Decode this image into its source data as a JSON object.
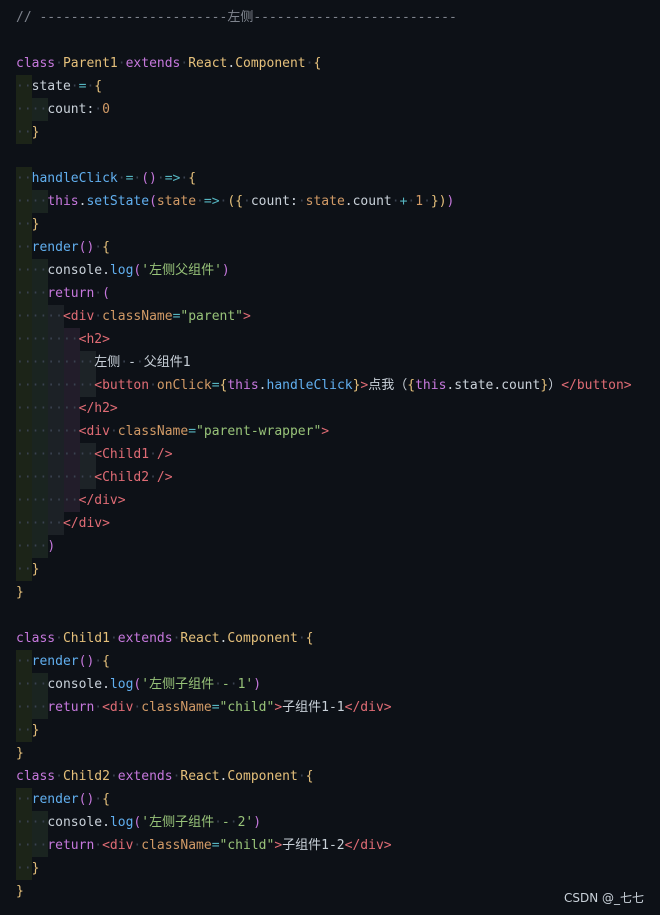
{
  "editor": {
    "lines": [
      [
        [
          "c",
          "// ------------------------左侧--------------------------"
        ]
      ],
      [],
      [
        [
          "k",
          "class"
        ],
        [
          "ws",
          "·"
        ],
        [
          "cl",
          "Parent1"
        ],
        [
          "ws",
          "·"
        ],
        [
          "k",
          "extends"
        ],
        [
          "ws",
          "·"
        ],
        [
          "cl",
          "React"
        ],
        [
          "p",
          "."
        ],
        [
          "cl",
          "Component"
        ],
        [
          "ws",
          "·"
        ],
        [
          "pb",
          "{"
        ]
      ],
      [
        [
          "p",
          "state"
        ],
        [
          "ws",
          "·"
        ],
        [
          "op",
          "="
        ],
        [
          "ws",
          "·"
        ],
        [
          "pb",
          "{"
        ]
      ],
      [
        [
          "p",
          "count"
        ],
        [
          "p",
          ":"
        ],
        [
          "ws",
          "·"
        ],
        [
          "n",
          "0"
        ]
      ],
      [
        [
          "pb",
          "}"
        ]
      ],
      [],
      [
        [
          "f",
          "handleClick"
        ],
        [
          "ws",
          "·"
        ],
        [
          "op",
          "="
        ],
        [
          "ws",
          "·"
        ],
        [
          "pp",
          "()"
        ],
        [
          "ws",
          "·"
        ],
        [
          "op",
          "=>"
        ],
        [
          "ws",
          "·"
        ],
        [
          "pb",
          "{"
        ]
      ],
      [
        [
          "k",
          "this"
        ],
        [
          "p",
          "."
        ],
        [
          "f",
          "setState"
        ],
        [
          "pp",
          "("
        ],
        [
          "a",
          "state"
        ],
        [
          "ws",
          "·"
        ],
        [
          "op",
          "=>"
        ],
        [
          "ws",
          "·"
        ],
        [
          "pb",
          "("
        ],
        [
          "pb",
          "{"
        ],
        [
          "ws",
          "·"
        ],
        [
          "p",
          "count"
        ],
        [
          "p",
          ":"
        ],
        [
          "ws",
          "·"
        ],
        [
          "a",
          "state"
        ],
        [
          "p",
          "."
        ],
        [
          "p",
          "count"
        ],
        [
          "ws",
          "·"
        ],
        [
          "op",
          "+"
        ],
        [
          "ws",
          "·"
        ],
        [
          "n",
          "1"
        ],
        [
          "ws",
          "·"
        ],
        [
          "pb",
          "}"
        ],
        [
          "pb",
          ")"
        ],
        [
          "pp",
          ")"
        ]
      ],
      [
        [
          "pb",
          "}"
        ]
      ],
      [
        [
          "f",
          "render"
        ],
        [
          "pp",
          "()"
        ],
        [
          "ws",
          "·"
        ],
        [
          "pb",
          "{"
        ]
      ],
      [
        [
          "p",
          "console"
        ],
        [
          "p",
          "."
        ],
        [
          "f",
          "log"
        ],
        [
          "pp",
          "("
        ],
        [
          "s",
          "'左侧父组件'"
        ],
        [
          "pp",
          ")"
        ]
      ],
      [
        [
          "k",
          "return"
        ],
        [
          "ws",
          "·"
        ],
        [
          "pp",
          "("
        ]
      ],
      [
        [
          "t",
          "<div"
        ],
        [
          "ws",
          "·"
        ],
        [
          "a",
          "className"
        ],
        [
          "op",
          "="
        ],
        [
          "s",
          "\"parent\""
        ],
        [
          "t",
          ">"
        ]
      ],
      [
        [
          "t",
          "<h2>"
        ]
      ],
      [
        [
          "p",
          "左侧"
        ],
        [
          "ws",
          "·"
        ],
        [
          "p",
          "-"
        ],
        [
          "ws",
          "·"
        ],
        [
          "p",
          "父组件1"
        ]
      ],
      [
        [
          "t",
          "<button"
        ],
        [
          "ws",
          "·"
        ],
        [
          "a",
          "onClick"
        ],
        [
          "op",
          "="
        ],
        [
          "pb",
          "{"
        ],
        [
          "k",
          "this"
        ],
        [
          "p",
          "."
        ],
        [
          "f",
          "handleClick"
        ],
        [
          "pb",
          "}"
        ],
        [
          "t",
          ">"
        ],
        [
          "p",
          "点我（"
        ],
        [
          "pb",
          "{"
        ],
        [
          "k",
          "this"
        ],
        [
          "p",
          "."
        ],
        [
          "p",
          "state"
        ],
        [
          "p",
          "."
        ],
        [
          "p",
          "count"
        ],
        [
          "pb",
          "}"
        ],
        [
          "p",
          "）"
        ],
        [
          "t",
          "</button>"
        ]
      ],
      [
        [
          "t",
          "</h2>"
        ]
      ],
      [
        [
          "t",
          "<div"
        ],
        [
          "ws",
          "·"
        ],
        [
          "a",
          "className"
        ],
        [
          "op",
          "="
        ],
        [
          "s",
          "\"parent-wrapper\""
        ],
        [
          "t",
          ">"
        ]
      ],
      [
        [
          "t",
          "<Child1"
        ],
        [
          "ws",
          "·"
        ],
        [
          "t",
          "/>"
        ]
      ],
      [
        [
          "t",
          "<Child2"
        ],
        [
          "ws",
          "·"
        ],
        [
          "t",
          "/>"
        ]
      ],
      [
        [
          "t",
          "</div>"
        ]
      ],
      [
        [
          "t",
          "</div>"
        ]
      ],
      [
        [
          "pp",
          ")"
        ]
      ],
      [
        [
          "pb",
          "}"
        ]
      ],
      [
        [
          "pb",
          "}"
        ]
      ],
      [],
      [
        [
          "k",
          "class"
        ],
        [
          "ws",
          "·"
        ],
        [
          "cl",
          "Child1"
        ],
        [
          "ws",
          "·"
        ],
        [
          "k",
          "extends"
        ],
        [
          "ws",
          "·"
        ],
        [
          "cl",
          "React"
        ],
        [
          "p",
          "."
        ],
        [
          "cl",
          "Component"
        ],
        [
          "ws",
          "·"
        ],
        [
          "pb",
          "{"
        ]
      ],
      [
        [
          "f",
          "render"
        ],
        [
          "pp",
          "()"
        ],
        [
          "ws",
          "·"
        ],
        [
          "pb",
          "{"
        ]
      ],
      [
        [
          "p",
          "console"
        ],
        [
          "p",
          "."
        ],
        [
          "f",
          "log"
        ],
        [
          "pp",
          "("
        ],
        [
          "s",
          "'左侧子组件"
        ],
        [
          "ws",
          "·"
        ],
        [
          "s",
          "-"
        ],
        [
          "ws",
          "·"
        ],
        [
          "s",
          "1'"
        ],
        [
          "pp",
          ")"
        ]
      ],
      [
        [
          "k",
          "return"
        ],
        [
          "ws",
          "·"
        ],
        [
          "t",
          "<div"
        ],
        [
          "ws",
          "·"
        ],
        [
          "a",
          "className"
        ],
        [
          "op",
          "="
        ],
        [
          "s",
          "\"child\""
        ],
        [
          "t",
          ">"
        ],
        [
          "p",
          "子组件1-1"
        ],
        [
          "t",
          "</div>"
        ]
      ],
      [
        [
          "pb",
          "}"
        ]
      ],
      [
        [
          "pb",
          "}"
        ]
      ],
      [
        [
          "k",
          "class"
        ],
        [
          "ws",
          "·"
        ],
        [
          "cl",
          "Child2"
        ],
        [
          "ws",
          "·"
        ],
        [
          "k",
          "extends"
        ],
        [
          "ws",
          "·"
        ],
        [
          "cl",
          "React"
        ],
        [
          "p",
          "."
        ],
        [
          "cl",
          "Component"
        ],
        [
          "ws",
          "·"
        ],
        [
          "pb",
          "{"
        ]
      ],
      [
        [
          "f",
          "render"
        ],
        [
          "pp",
          "()"
        ],
        [
          "ws",
          "·"
        ],
        [
          "pb",
          "{"
        ]
      ],
      [
        [
          "p",
          "console"
        ],
        [
          "p",
          "."
        ],
        [
          "f",
          "log"
        ],
        [
          "pp",
          "("
        ],
        [
          "s",
          "'左侧子组件"
        ],
        [
          "ws",
          "·"
        ],
        [
          "s",
          "-"
        ],
        [
          "ws",
          "·"
        ],
        [
          "s",
          "2'"
        ],
        [
          "pp",
          ")"
        ]
      ],
      [
        [
          "k",
          "return"
        ],
        [
          "ws",
          "·"
        ],
        [
          "t",
          "<div"
        ],
        [
          "ws",
          "·"
        ],
        [
          "a",
          "className"
        ],
        [
          "op",
          "="
        ],
        [
          "s",
          "\"child\""
        ],
        [
          "t",
          ">"
        ],
        [
          "p",
          "子组件1-2"
        ],
        [
          "t",
          "</div>"
        ]
      ],
      [
        [
          "pb",
          "}"
        ]
      ],
      [
        [
          "pb",
          "}"
        ]
      ]
    ]
  },
  "watermark": "CSDN @_七七"
}
